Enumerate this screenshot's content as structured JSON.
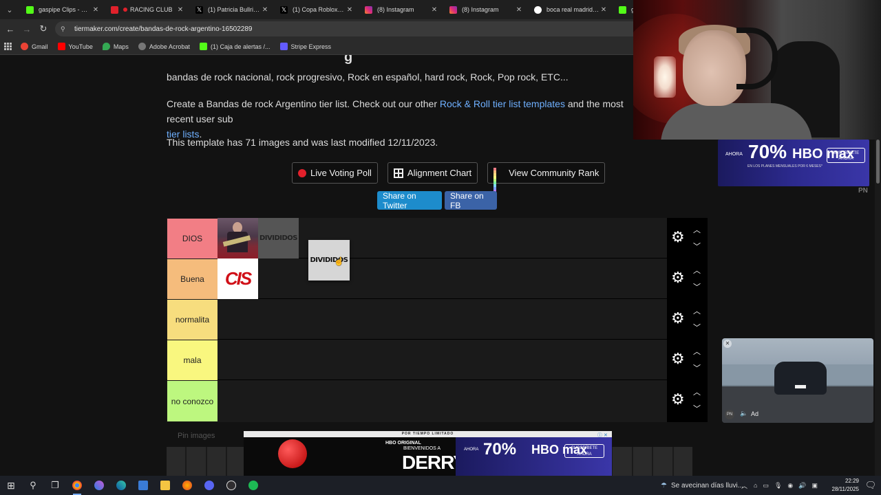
{
  "browser": {
    "tabs": [
      {
        "title": "gaspipe Clips - Watch",
        "favicon_color": "#53fc18"
      },
      {
        "title": "RACING CLUB",
        "favicon_color": "#e0212b",
        "recording": true
      },
      {
        "title": "(1) Patricia Bullrich en",
        "favicon_color": "#000000"
      },
      {
        "title": "(1) Copa Roblox (@C",
        "favicon_color": "#000000"
      },
      {
        "title": "(8) Instagram",
        "favicon_color": "#d6249f"
      },
      {
        "title": "(8) Instagram",
        "favicon_color": "#d6249f"
      },
      {
        "title": "boca real madrid - B",
        "favicon_color": "#4285f4"
      },
      {
        "title": "ga",
        "favicon_color": "#53fc18"
      }
    ],
    "url": "tiermaker.com/create/bandas-de-rock-argentino-16502289",
    "bookmarks": [
      {
        "label": "Gmail",
        "color": "#ea4335"
      },
      {
        "label": "YouTube",
        "color": "#ff0000"
      },
      {
        "label": "Maps",
        "color": "#34a853"
      },
      {
        "label": "Adobe Acrobat",
        "color": "#b30b00"
      },
      {
        "label": "(1) Caja de alertas /...",
        "color": "#53fc18"
      },
      {
        "label": "Stripe Express",
        "color": "#635bff"
      }
    ]
  },
  "page": {
    "heading_fragment": "g",
    "genres": "bandas de rock nacional, rock progresivo, Rock en español, hard rock, Rock, Pop rock, ETC...",
    "intro_before": "Create a Bandas de rock Argentino tier list. Check out our other ",
    "intro_link1": "Rock & Roll tier list templates",
    "intro_middle": " and the most recent user sub",
    "intro_link2": "tier lists",
    "intro_end": ".",
    "template_info": "This template has 71 images and was last modified 12/11/2023.",
    "buttons": {
      "live_voting": "Live Voting Poll",
      "alignment": "Alignment Chart",
      "community_rank": "View Community Rank",
      "share_twitter": "Share on Twitter",
      "share_fb": "Share on FB"
    },
    "tiers": [
      {
        "label": "DIOS",
        "color": "#f27e85"
      },
      {
        "label": "Buena",
        "color": "#f5bc7c"
      },
      {
        "label": "normalita",
        "color": "#f7dd7e"
      },
      {
        "label": "mala",
        "color": "#f9f77f"
      },
      {
        "label": "no conozco",
        "color": "#bdf77f"
      }
    ],
    "tier_items": {
      "divididos_text": "DIVIDIDOS",
      "cis_text": "CIS"
    },
    "pin_images_label": "Pin images"
  },
  "ads": {
    "side_pct": "70%",
    "side_ahora": "AHORA",
    "side_brand": "HBO max",
    "side_cta": "SUSCRÍBETE AHORA",
    "side_sub": "EN LOS PLANES MENSUALES POR 6 MESES*",
    "pn": "PN",
    "video_ad_label": "Ad",
    "video_pn": "PN",
    "banner_top": "POR TIEMPO LIMITADO",
    "banner_hbo": "HBO ORIGINAL",
    "banner_bienvenidos": "BIENVENIDOS A",
    "banner_derry": "DERRY",
    "banner_ahora": "AHORA",
    "banner_pct": "70%",
    "banner_brand": "HBO max",
    "banner_cta": "SUSCRÍBETE AHORA"
  },
  "taskbar": {
    "weather": "Se avecinan días lluvi...",
    "time": "22:29",
    "date": "28/11/2025"
  }
}
